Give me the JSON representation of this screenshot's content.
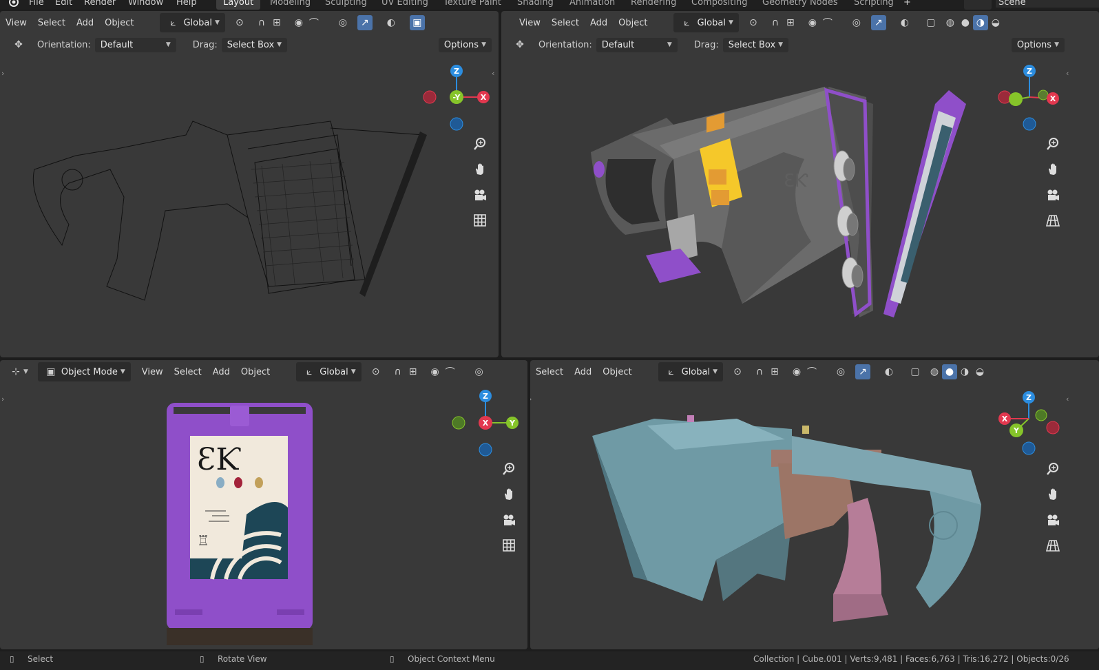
{
  "topbar": {
    "menus": [
      "File",
      "Edit",
      "Render",
      "Window",
      "Help"
    ],
    "workspaces": [
      "Layout",
      "Modeling",
      "Sculpting",
      "UV Editing",
      "Texture Paint",
      "Shading",
      "Animation",
      "Rendering",
      "Compositing",
      "Geometry Nodes",
      "Scripting"
    ],
    "active_workspace": "Layout",
    "add_tab": "+",
    "scene": "Scene"
  },
  "viewport_menus": {
    "view": "View",
    "select": "Select",
    "add": "Add",
    "object": "Object"
  },
  "transform_orientation": "Global",
  "mode": "Object Mode",
  "tool_settings": {
    "orientation_label": "Orientation:",
    "orientation_value": "Default",
    "drag_label": "Drag:",
    "drag_value": "Select Box",
    "options": "Options"
  },
  "gizmo_labels": {
    "z": "Z",
    "x": "X",
    "y": "Y",
    "neg_y": "-Y"
  },
  "decal_text": "ƐƘ",
  "status": {
    "select": "Select",
    "rotate": "Rotate View",
    "context": "Object Context Menu",
    "stats": "Collection | Cube.001 | Verts:9,481 | Faces:6,763 | Tris:16,272 | Objects:0/26"
  },
  "colors": {
    "viewport_bg": "#393939",
    "accent_blue": "#4b73a9",
    "axis_x": "#e2384f",
    "axis_y": "#86c42a",
    "axis_z": "#2c8ddf",
    "purple_part": "#8f4fc9",
    "yellow_panel": "#f5c82a",
    "teal_material": "#6f9aa5",
    "pink_material": "#b67d98"
  },
  "icons": [
    "blender-logo-icon",
    "move-tool-icon",
    "snap-icon",
    "proportional-icon",
    "visibility-icon",
    "gizmo-icon",
    "overlay-icon",
    "xray-icon",
    "shading-wire-icon",
    "shading-solid-icon",
    "shading-material-icon",
    "shading-rendered-icon",
    "zoom-icon",
    "pan-hand-icon",
    "camera-icon",
    "grid-icon",
    "perspective-icon"
  ]
}
